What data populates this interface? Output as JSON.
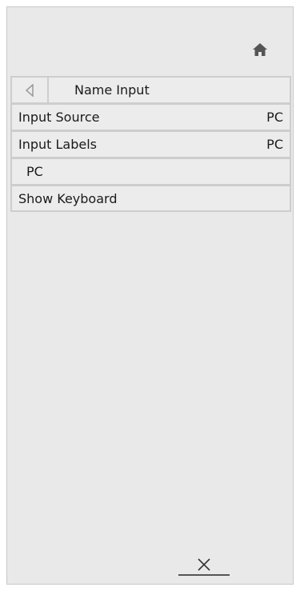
{
  "header": {
    "title": "Name Input",
    "back_icon": "back-triangle-icon",
    "home_icon": "home-icon"
  },
  "menu": {
    "items": [
      {
        "label": "Input Source",
        "value": "PC"
      },
      {
        "label": "Input Labels",
        "value": "PC"
      },
      {
        "label": "PC",
        "value": ""
      },
      {
        "label": "Show Keyboard",
        "value": ""
      }
    ]
  },
  "footer": {
    "close_icon": "close-icon"
  }
}
